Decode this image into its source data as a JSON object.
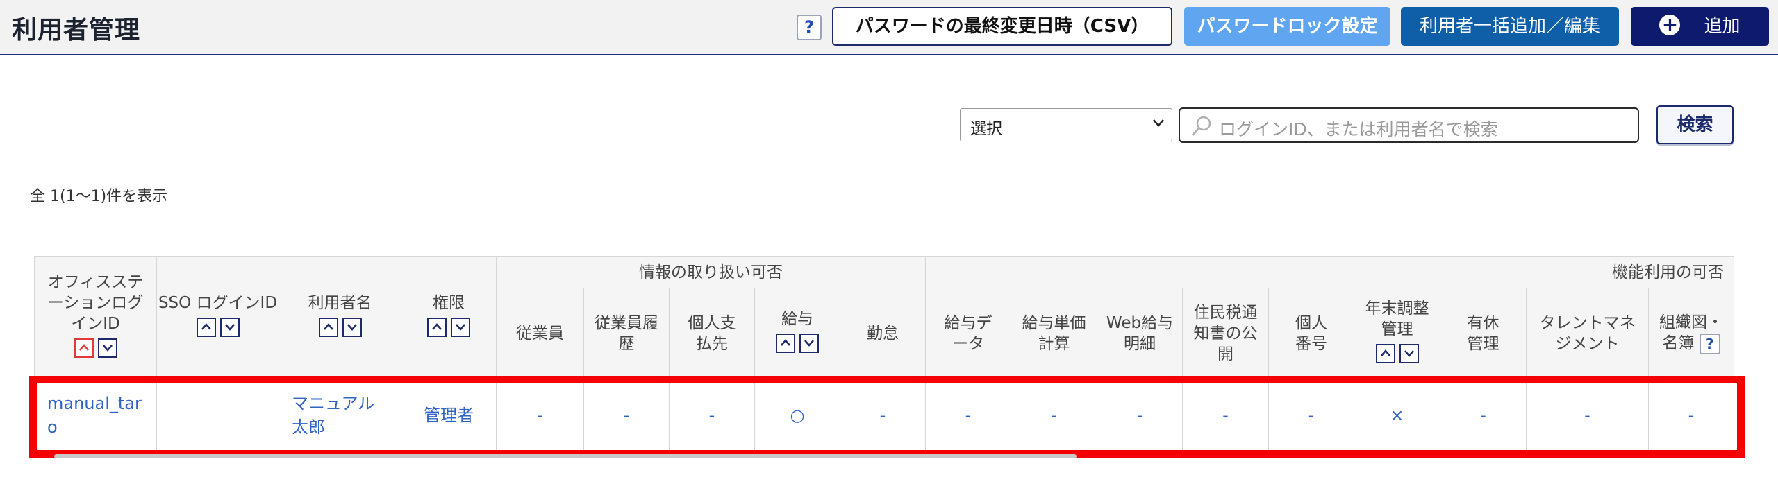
{
  "header": {
    "title": "利用者管理",
    "help_label": "?",
    "csv_button": "パスワードの最終変更日時（CSV）",
    "lock_button": "パスワードロック設定",
    "bulk_button": "利用者一括追加／編集",
    "add_button": "追加",
    "add_icon": "plus-circle-icon"
  },
  "search": {
    "select_value": "選択",
    "placeholder": "ログインID、または利用者名で検索",
    "search_button": "検索"
  },
  "result_count": "全 1(1〜1)件を表示",
  "table": {
    "col_login_id": "オフィスステーションログインID",
    "col_sso": "SSO ログインID",
    "col_name": "利用者名",
    "col_role": "権限",
    "group_info": "情報の取り扱い可否",
    "group_func": "機能利用の可否",
    "info_cols": [
      "従業員",
      "従業員履歴",
      "個人支払先",
      "給与",
      "勤怠"
    ],
    "func_cols": [
      "給与データ",
      "給与単価計算",
      "Web給与明細",
      "住民税通知書の公開",
      "個人番号",
      "年末調整管理",
      "有休管理",
      "タレントマネジメント",
      "組織図・名簿"
    ],
    "rows": [
      {
        "login_id": "manual_taro",
        "sso_id": "",
        "name": "マニュアル太郎",
        "role": "管理者",
        "info": [
          "-",
          "-",
          "-",
          "○",
          "-"
        ],
        "func": [
          "-",
          "-",
          "-",
          "-",
          "-",
          "×",
          "-",
          "-",
          "-"
        ]
      }
    ]
  },
  "colors": {
    "highlight": "#f40000",
    "link": "#2f63c4",
    "navy": "#0e1a6e"
  }
}
